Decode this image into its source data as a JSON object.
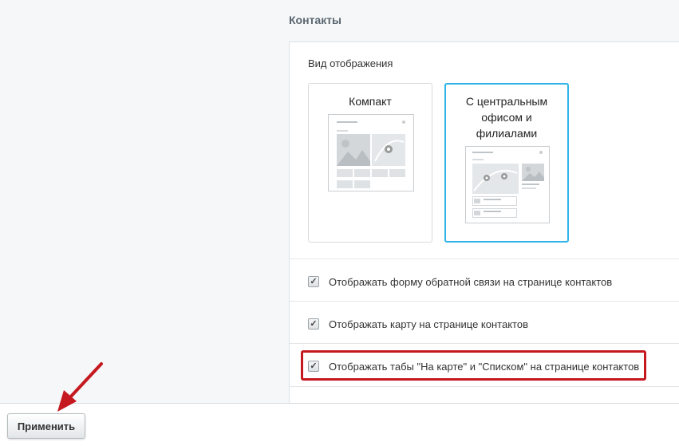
{
  "section": {
    "title": "Контакты"
  },
  "view": {
    "label": "Вид отображения",
    "options": [
      {
        "title": "Компакт",
        "selected": false
      },
      {
        "title": "С центральным офисом и филиалами",
        "selected": true
      }
    ]
  },
  "settings": [
    {
      "label": "Отображать форму обратной связи на странице контактов",
      "checked": true
    },
    {
      "label": "Отображать карту на странице контактов",
      "checked": true
    },
    {
      "label": "Отображать табы \"На карте\" и \"Списком\" на странице контактов",
      "checked": true,
      "highlighted": true
    }
  ],
  "footer": {
    "apply_label": "Применить"
  },
  "colors": {
    "selected_border": "#2fb4e9",
    "highlight": "#c5181f",
    "arrow": "#c5181f"
  }
}
